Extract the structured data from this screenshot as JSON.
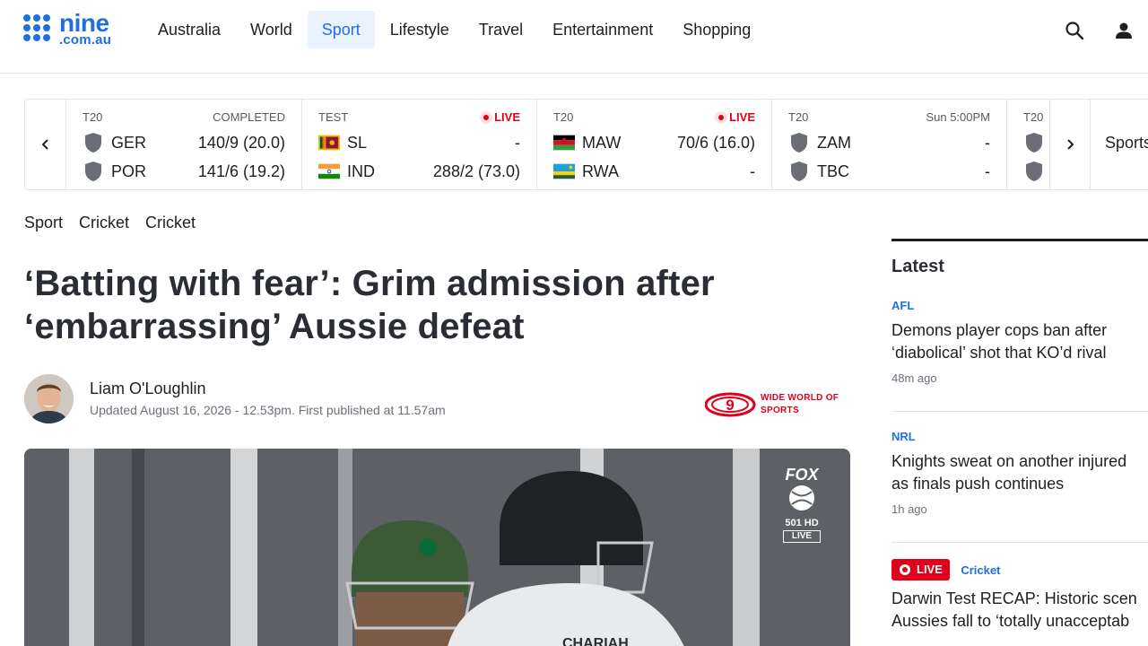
{
  "header": {
    "logo_primary": "nine",
    "logo_secondary": ".com.au",
    "nav": [
      {
        "label": "Australia",
        "active": false
      },
      {
        "label": "World",
        "active": false
      },
      {
        "label": "Sport",
        "active": true
      },
      {
        "label": "Lifestyle",
        "active": false
      },
      {
        "label": "Travel",
        "active": false
      },
      {
        "label": "Entertainment",
        "active": false
      },
      {
        "label": "Shopping",
        "active": false
      }
    ],
    "icons": [
      "search-icon",
      "user-icon"
    ]
  },
  "scores": {
    "matches": [
      {
        "format": "T20",
        "status": "COMPLETED",
        "live": false,
        "teams": [
          {
            "name": "GER",
            "score": "140/9 (20.0)"
          },
          {
            "name": "POR",
            "score": "141/6 (19.2)"
          }
        ]
      },
      {
        "format": "TEST",
        "status": "LIVE",
        "live": true,
        "teams": [
          {
            "name": "SL",
            "score": "-"
          },
          {
            "name": "IND",
            "score": "288/2 (73.0)"
          }
        ]
      },
      {
        "format": "T20",
        "status": "LIVE",
        "live": true,
        "teams": [
          {
            "name": "MAW",
            "score": "70/6 (16.0)"
          },
          {
            "name": "RWA",
            "score": "-"
          }
        ]
      },
      {
        "format": "T20",
        "status": "Sun 5:00PM",
        "live": false,
        "teams": [
          {
            "name": "ZAM",
            "score": "-"
          },
          {
            "name": "TBC",
            "score": "-"
          }
        ]
      },
      {
        "format": "T20",
        "status": "",
        "live": false,
        "teams": [
          {
            "name": "",
            "score": ""
          },
          {
            "name": "",
            "score": ""
          }
        ]
      }
    ],
    "sports_link": "Sports"
  },
  "breadcrumbs": [
    "Sport",
    "Cricket",
    "Cricket"
  ],
  "article": {
    "headline_line1": "‘Batting with fear’: Grim admission after",
    "headline_line2": "‘embarrassing’ Aussie defeat",
    "author": "Liam O'Loughlin",
    "updated": "Updated August 16, 2026 - 12.53pm. First published at 11.57am",
    "publisher_logo": "WIDE WORLD OF SPORTS",
    "hero_overlay": {
      "brand": "FOX",
      "channel": "501 HD",
      "live": "LIVE"
    }
  },
  "sidebar": {
    "title": "Latest",
    "stories": [
      {
        "category": "AFL",
        "line1": "Demons player cops ban after",
        "line2": "‘diabolical’ shot that KO’d rival",
        "time": "48m ago",
        "live": false
      },
      {
        "category": "NRL",
        "line1": "Knights sweat on another injured",
        "line2": "as finals push continues",
        "time": "1h ago",
        "live": false
      },
      {
        "category": "Cricket",
        "live_label": "LIVE",
        "line1": "Darwin Test RECAP: Historic scen",
        "line2": "Aussies fall to ‘totally unacceptab",
        "live": true
      }
    ]
  },
  "colors": {
    "accent": "#1f6fe3",
    "live": "#e0001b",
    "text": "#1d2023"
  }
}
